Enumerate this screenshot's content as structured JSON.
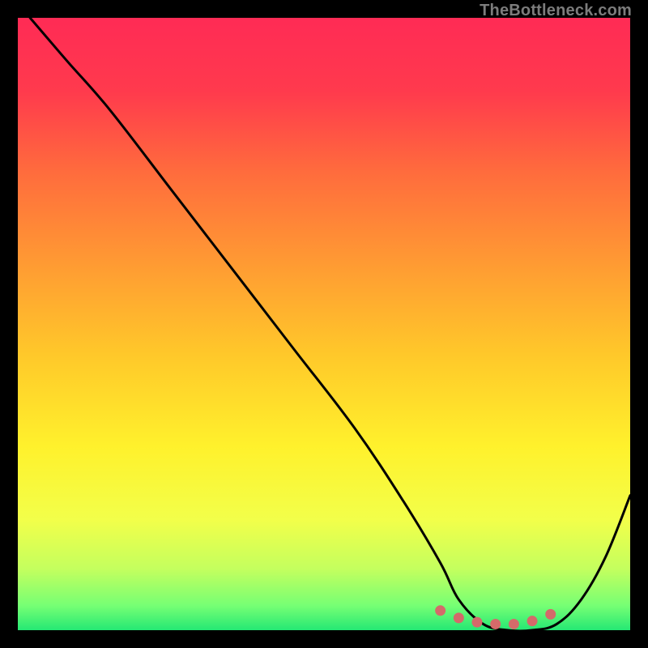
{
  "watermark": "TheBottleneck.com",
  "gradient": {
    "stops": [
      {
        "offset": 0.0,
        "color": "#ff2b55"
      },
      {
        "offset": 0.12,
        "color": "#ff3a4d"
      },
      {
        "offset": 0.25,
        "color": "#ff6b3d"
      },
      {
        "offset": 0.4,
        "color": "#ff9a33"
      },
      {
        "offset": 0.55,
        "color": "#ffc82a"
      },
      {
        "offset": 0.7,
        "color": "#fff12c"
      },
      {
        "offset": 0.82,
        "color": "#f2ff4a"
      },
      {
        "offset": 0.9,
        "color": "#c4ff5e"
      },
      {
        "offset": 0.96,
        "color": "#76ff74"
      },
      {
        "offset": 1.0,
        "color": "#25e874"
      }
    ]
  },
  "chart_data": {
    "type": "line",
    "title": "",
    "xlabel": "",
    "ylabel": "",
    "xlim": [
      0,
      100
    ],
    "ylim": [
      0,
      100
    ],
    "series": [
      {
        "name": "bottleneck-curve",
        "x": [
          2,
          8,
          15,
          25,
          35,
          45,
          55,
          63,
          69,
          72,
          76,
          80,
          84,
          88,
          92,
          96,
          100
        ],
        "values": [
          100,
          93,
          85,
          72,
          59,
          46,
          33,
          21,
          11,
          5,
          1,
          0,
          0,
          1,
          5,
          12,
          22
        ]
      }
    ],
    "highlight": {
      "name": "optimal-range",
      "x": [
        69,
        72,
        75,
        78,
        81,
        84,
        87
      ],
      "values": [
        3.2,
        2.0,
        1.3,
        1.0,
        1.0,
        1.5,
        2.6
      ]
    }
  }
}
